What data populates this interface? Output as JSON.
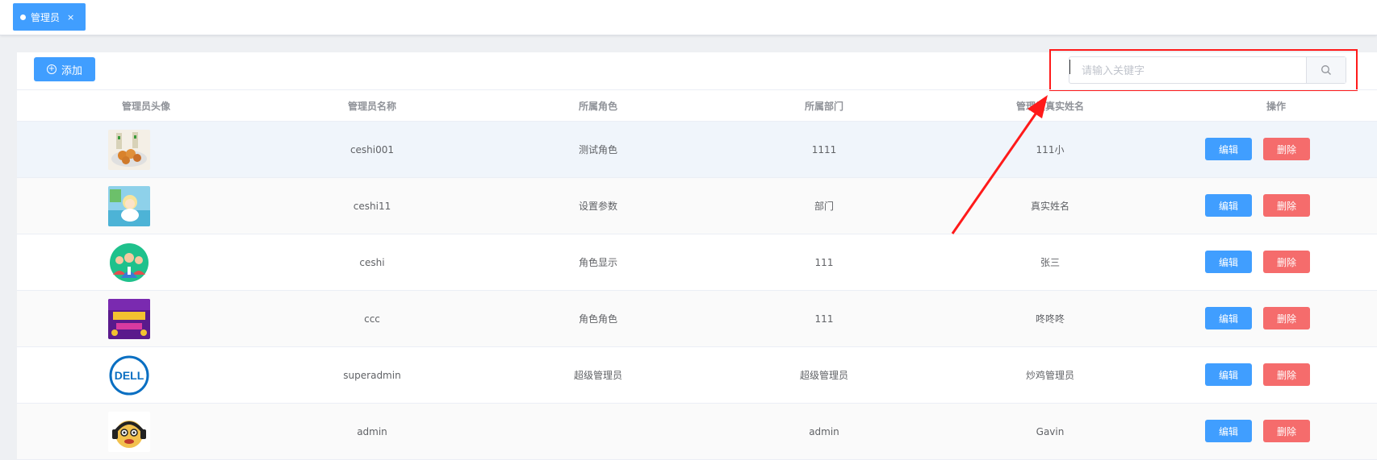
{
  "tabs": [
    {
      "label": "管理员",
      "close": "×"
    }
  ],
  "toolbar": {
    "add_label": "添加",
    "add_icon": "plus-circle-icon"
  },
  "search": {
    "placeholder": "请输入关键字",
    "value": "",
    "icon": "search-icon"
  },
  "table": {
    "headers": [
      "管理员头像",
      "管理员名称",
      "所属角色",
      "所属部门",
      "管理员真实姓名",
      "操作"
    ],
    "rows": [
      {
        "avatar": "food-photo-avatar",
        "name": "ceshi001",
        "role": "测试角色",
        "dept": "1111",
        "realname": "111小",
        "edit": "编辑",
        "delete": "删除"
      },
      {
        "avatar": "cartoon-girl-avatar",
        "name": "ceshi11",
        "role": "设置参数",
        "dept": "部门",
        "realname": "真实姓名",
        "edit": "编辑",
        "delete": "删除"
      },
      {
        "avatar": "team-people-avatar",
        "name": "ceshi",
        "role": "角色显示",
        "dept": "111",
        "realname": "张三",
        "edit": "编辑",
        "delete": "删除"
      },
      {
        "avatar": "purple-promo-avatar",
        "name": "ccc",
        "role": "角色角色",
        "dept": "111",
        "realname": "咚咚咚",
        "edit": "编辑",
        "delete": "删除"
      },
      {
        "avatar": "dell-logo-avatar",
        "name": "superadmin",
        "role": "超级管理员",
        "dept": "超级管理员",
        "realname": "炒鸡管理员",
        "edit": "编辑",
        "delete": "删除"
      },
      {
        "avatar": "headphone-character-avatar",
        "name": "admin",
        "role": "",
        "dept": "admin",
        "realname": "Gavin",
        "edit": "编辑",
        "delete": "删除"
      }
    ]
  },
  "avatar_texts": {
    "dell_logo": "DELL"
  },
  "colors": {
    "primary": "#409eff",
    "danger": "#f56c6c",
    "annotation": "#ff1a1a"
  }
}
